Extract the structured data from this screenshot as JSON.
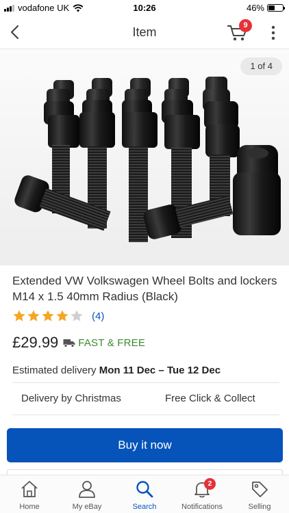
{
  "status_bar": {
    "carrier": "vodafone UK",
    "time": "10:26",
    "battery_percent": "46%",
    "battery_level": 0.46,
    "icons": [
      "signal-icon",
      "wifi-icon",
      "battery-icon"
    ]
  },
  "nav": {
    "title": "Item",
    "cart_count": "9",
    "icons": [
      "back-icon",
      "cart-icon",
      "more-icon"
    ]
  },
  "gallery": {
    "counter": "1 of 4"
  },
  "item": {
    "title": "Extended VW Volkswagen Wheel Bolts and lockers M14 x 1.5 40mm Radius (Black)",
    "rating_stars": 4,
    "rating_max": 5,
    "review_count": "(4)",
    "price": "£29.99",
    "shipping": "FAST & FREE",
    "delivery_label": "Estimated delivery",
    "delivery_dates": "Mon 11 Dec – Tue 12 Dec",
    "features": [
      "Delivery by Christmas",
      "Free Click & Collect"
    ],
    "buy_label": "Buy it now"
  },
  "colors": {
    "brand_blue": "#0654ba",
    "star_gold": "#f5a623",
    "shipping_green": "#3a8a2c",
    "badge_red": "#e53238"
  },
  "tabs": [
    {
      "label": "Home",
      "icon": "home-icon"
    },
    {
      "label": "My eBay",
      "icon": "person-icon"
    },
    {
      "label": "Search",
      "icon": "search-icon",
      "active": true
    },
    {
      "label": "Notifications",
      "icon": "bell-icon",
      "badge": "2"
    },
    {
      "label": "Selling",
      "icon": "tag-icon"
    }
  ]
}
